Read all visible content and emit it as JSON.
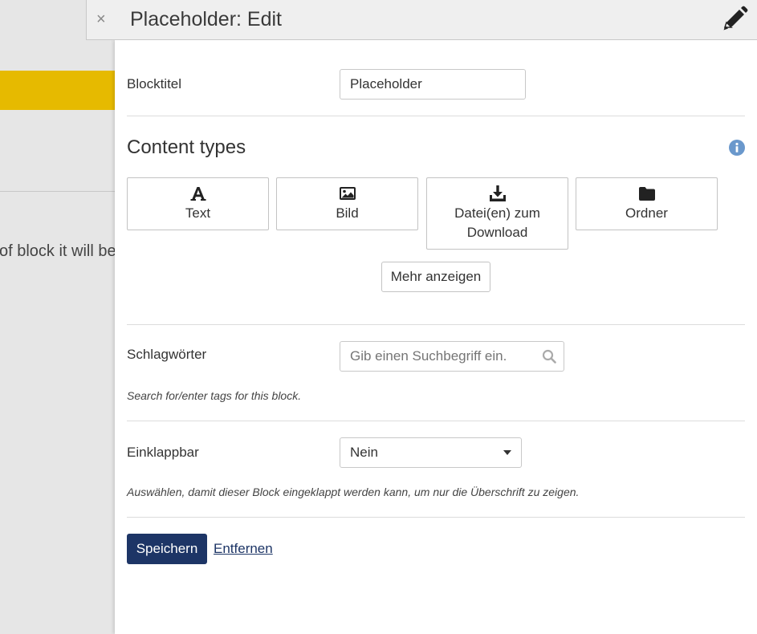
{
  "background": {
    "snippet": "of block it will be"
  },
  "header": {
    "close_glyph": "×",
    "title": "Placeholder: Edit"
  },
  "form": {
    "blocktitle": {
      "label": "Blocktitel",
      "value": "Placeholder"
    },
    "content_types": {
      "title": "Content types",
      "items": [
        {
          "label": "Text",
          "icon": "font-icon"
        },
        {
          "label": "Bild",
          "icon": "image-icon"
        },
        {
          "label": "Datei(en) zum Download",
          "icon": "download-icon"
        },
        {
          "label": "Ordner",
          "icon": "folder-icon"
        }
      ],
      "more_label": "Mehr anzeigen"
    },
    "tags": {
      "label": "Schlagwörter",
      "placeholder": "Gib einen Suchbegriff ein.",
      "help": "Search for/enter tags for this block."
    },
    "collapsible": {
      "label": "Einklappbar",
      "value": "Nein",
      "help": "Auswählen, damit dieser Block eingeklappt werden kann, um nur die Überschrift zu zeigen."
    },
    "actions": {
      "save_label": "Speichern",
      "remove_label": "Entfernen"
    }
  },
  "colors": {
    "accent_yellow": "#e6ba00",
    "primary_button": "#1d3566",
    "info_icon": "#6a98cc"
  }
}
